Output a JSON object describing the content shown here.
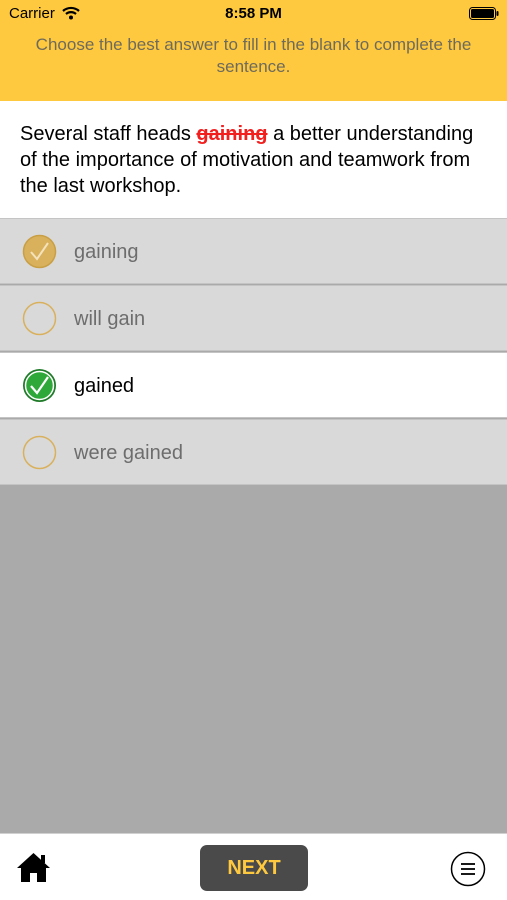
{
  "status_bar": {
    "carrier": "Carrier",
    "time": "8:58 PM",
    "wifi_icon": "wifi-icon",
    "battery_icon": "battery-icon"
  },
  "instruction": "Choose the best answer to fill in the blank to complete the sentence.",
  "question": {
    "before": "Several staff heads ",
    "wrong_answer": "gaining",
    "after": " a better understanding of the importance of motivation and teamwork from the last workshop."
  },
  "options": [
    {
      "label": "gaining",
      "state": "wrong-checked"
    },
    {
      "label": "will gain",
      "state": "unchecked"
    },
    {
      "label": "gained",
      "state": "correct"
    },
    {
      "label": "were gained",
      "state": "unchecked"
    }
  ],
  "bottom_bar": {
    "home_icon": "home-icon",
    "next_label": "NEXT",
    "menu_icon": "menu-icon"
  },
  "colors": {
    "header_yellow": "#fec93e",
    "correct_green": "#2fa83a",
    "muted_gold": "#d9b15d",
    "wrong_red": "#f21f1f",
    "button_dark": "#4a4a4a"
  }
}
